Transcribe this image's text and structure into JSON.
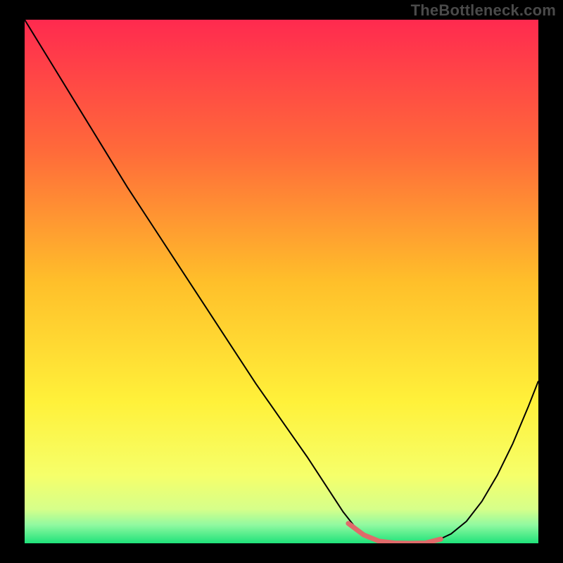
{
  "watermark": "TheBottleneck.com",
  "chart_data": {
    "type": "line",
    "title": "",
    "xlabel": "",
    "ylabel": "",
    "xlim": [
      0,
      100
    ],
    "ylim": [
      0,
      100
    ],
    "grid": false,
    "legend": false,
    "background_gradient_stops": [
      {
        "offset": 0.0,
        "color": "#ff2a4f"
      },
      {
        "offset": 0.25,
        "color": "#ff6a3a"
      },
      {
        "offset": 0.5,
        "color": "#ffbf2a"
      },
      {
        "offset": 0.73,
        "color": "#fff13a"
      },
      {
        "offset": 0.87,
        "color": "#f6ff6a"
      },
      {
        "offset": 0.935,
        "color": "#d6ff8a"
      },
      {
        "offset": 0.965,
        "color": "#90f9a0"
      },
      {
        "offset": 1.0,
        "color": "#1fe27a"
      }
    ],
    "series": [
      {
        "name": "bottleneck-curve",
        "color": "#000000",
        "x": [
          0,
          5,
          10,
          15,
          20,
          25,
          30,
          35,
          40,
          45,
          50,
          55,
          60,
          62,
          64,
          66,
          69,
          72,
          75,
          78,
          80,
          83,
          86,
          89,
          92,
          95,
          98,
          100
        ],
        "y": [
          100,
          92,
          84,
          76,
          68,
          60.5,
          53,
          45.5,
          38,
          30.5,
          23.5,
          16.5,
          9,
          6,
          3.5,
          1.6,
          0.4,
          0.05,
          0,
          0.05,
          0.4,
          1.8,
          4.2,
          8,
          13,
          19,
          26,
          31
        ]
      },
      {
        "name": "sweet-spot-marker",
        "color": "#e06a6a",
        "stroke_width": 7,
        "x": [
          63,
          66,
          69,
          72,
          75,
          78,
          81
        ],
        "y": [
          3.8,
          1.6,
          0.4,
          0.05,
          0,
          0.05,
          0.8
        ]
      }
    ]
  }
}
